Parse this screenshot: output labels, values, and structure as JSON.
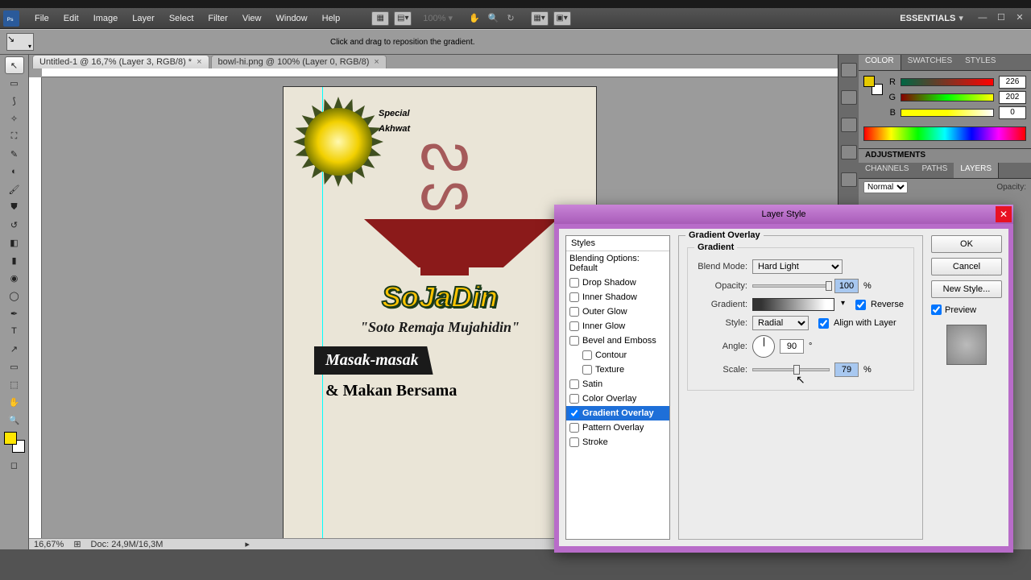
{
  "menubar": {
    "items": [
      "File",
      "Edit",
      "Image",
      "Layer",
      "Select",
      "Filter",
      "View",
      "Window",
      "Help"
    ],
    "workspace": "ESSENTIALS"
  },
  "options_bar": {
    "hint": "Click and drag to reposition the gradient."
  },
  "tabs": [
    {
      "label": "Untitled-1 @ 16,7% (Layer 3, RGB/8) *"
    },
    {
      "label": "bowl-hi.png @ 100% (Layer 0, RGB/8)"
    }
  ],
  "status": {
    "zoom": "16,67%",
    "doc": "Doc: 24,9M/16,3M"
  },
  "canvas": {
    "special1": "Special",
    "special2": "Akhwat",
    "logo": "SoJaDin",
    "tagline": "\"Soto Remaja Mujahidin\"",
    "banner": "Masak-masak",
    "subline": "& Makan Bersama"
  },
  "color_panel": {
    "tabs": [
      "COLOR",
      "SWATCHES",
      "STYLES"
    ],
    "r_label": "R",
    "g_label": "G",
    "b_label": "B",
    "r": "226",
    "g": "202",
    "b": "0",
    "adjustments": "ADJUSTMENTS",
    "layer_tabs": [
      "CHANNELS",
      "PATHS",
      "LAYERS"
    ],
    "blend": "Normal",
    "opacity_lbl": "Opacity:"
  },
  "dialog": {
    "title": "Layer Style",
    "styles_header": "Styles",
    "blending_default": "Blending Options: Default",
    "items": {
      "drop_shadow": "Drop Shadow",
      "inner_shadow": "Inner Shadow",
      "outer_glow": "Outer Glow",
      "inner_glow": "Inner Glow",
      "bevel": "Bevel and Emboss",
      "contour": "Contour",
      "texture": "Texture",
      "satin": "Satin",
      "color_overlay": "Color Overlay",
      "gradient_overlay": "Gradient Overlay",
      "pattern_overlay": "Pattern Overlay",
      "stroke": "Stroke"
    },
    "section": "Gradient Overlay",
    "group": "Gradient",
    "blend_mode_lbl": "Blend Mode:",
    "blend_mode": "Hard Light",
    "opacity_lbl": "Opacity:",
    "opacity": "100",
    "gradient_lbl": "Gradient:",
    "reverse": "Reverse",
    "style_lbl": "Style:",
    "style": "Radial",
    "align": "Align with Layer",
    "angle_lbl": "Angle:",
    "angle": "90",
    "scale_lbl": "Scale:",
    "scale": "79",
    "pct": "%",
    "deg": "°",
    "ok": "OK",
    "cancel": "Cancel",
    "new_style": "New Style...",
    "preview": "Preview"
  }
}
